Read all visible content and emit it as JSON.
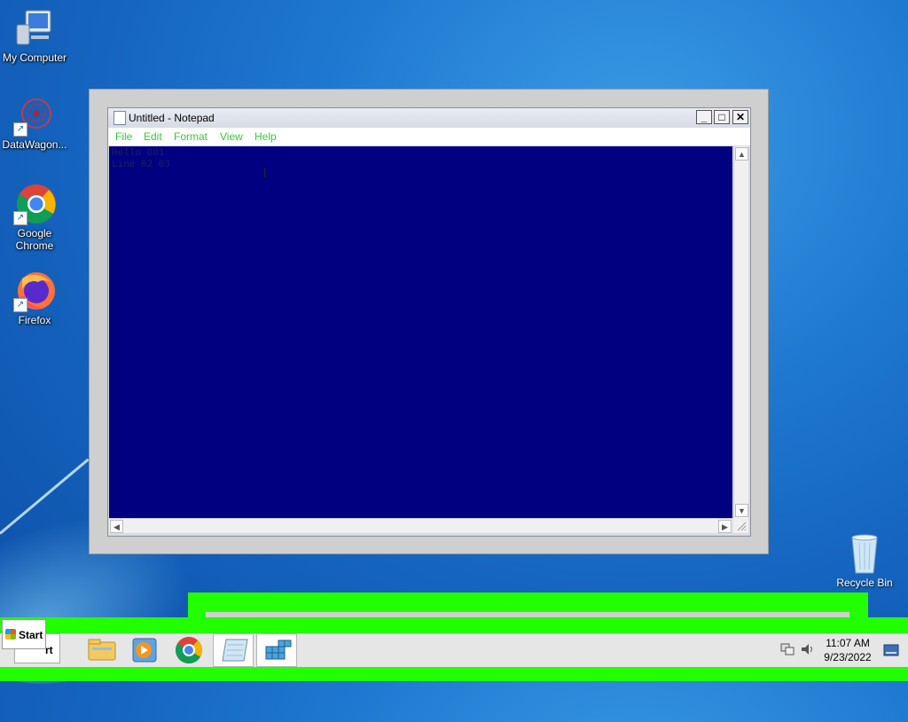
{
  "desktop": {
    "icons": [
      {
        "label": "My Computer",
        "icon": "computer-icon"
      },
      {
        "label": "DataWagon...",
        "icon": "datawagon-icon"
      },
      {
        "label": "Google Chrome",
        "icon": "chrome-icon"
      },
      {
        "label": "Firefox",
        "icon": "firefox-icon"
      },
      {
        "label": "Recycle Bin",
        "icon": "recycle-bin-icon"
      }
    ]
  },
  "notepad": {
    "title": "Untitled - Notepad",
    "menu": [
      "File",
      "Edit",
      "Format",
      "View",
      "Help"
    ],
    "content_lines": [
      "Hello 001",
      "Line 02 03"
    ],
    "accent_color": "#000080",
    "menu_color": "#33cc33"
  },
  "taskbar": {
    "start_label": "Start",
    "start_label_partial": "rt",
    "apps": [
      "explorer-icon",
      "media-player-icon",
      "chrome-icon",
      "notepad-icon",
      "registry-icon"
    ],
    "clock": {
      "time": "11:07 AM",
      "date": "9/23/2022"
    }
  }
}
